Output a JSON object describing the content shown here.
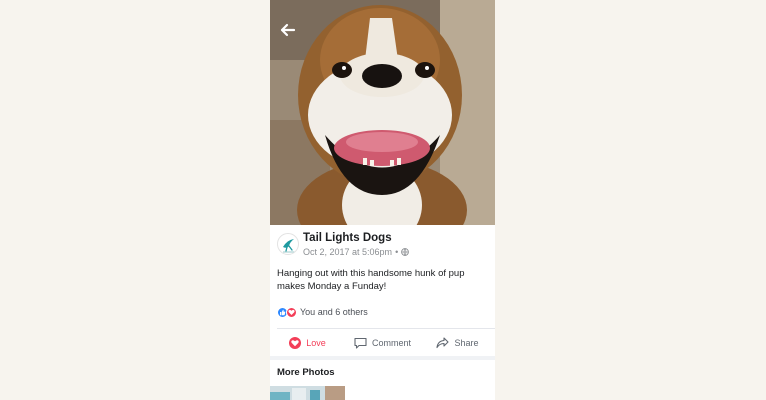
{
  "post": {
    "page_name": "Tail Lights Dogs",
    "timestamp": "Oct 2, 2017 at 5:06pm",
    "separator": "•",
    "privacy_icon": "globe-icon",
    "caption": "Hanging out with this handsome hunk of pup makes Monday a Funday!",
    "reactions_text": "You and 6 others",
    "reaction_icons": [
      "like-icon",
      "love-icon"
    ]
  },
  "actions": {
    "love_label": "Love",
    "comment_label": "Comment",
    "share_label": "Share"
  },
  "more_photos": {
    "title": "More Photos"
  },
  "colors": {
    "love": "#f33e58",
    "like": "#2d88ff",
    "brand_teal": "#1e9aa0"
  }
}
